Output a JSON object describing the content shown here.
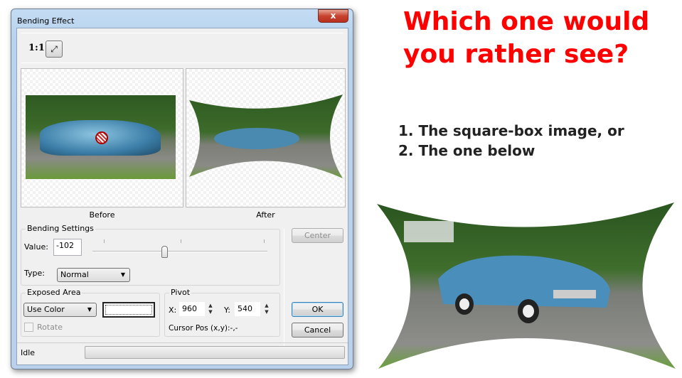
{
  "dialog": {
    "title": "Bending Effect",
    "close_label": "x",
    "toolbar": {
      "ratio_label": "1:1",
      "fit_icon": "fit-to-window-icon"
    },
    "preview": {
      "before_label": "Before",
      "after_label": "After"
    },
    "bending_settings": {
      "group_label": "Bending Settings",
      "value_label": "Value:",
      "value": "-102",
      "slider_percent": 41,
      "type_label": "Type:",
      "type_value": "Normal"
    },
    "exposed_area": {
      "group_label": "Exposed Area",
      "mode_value": "Use Color",
      "color": "#ffffff",
      "rotate_label": "Rotate",
      "rotate_checked": false
    },
    "pivot": {
      "group_label": "Pivot",
      "x_label": "X:",
      "x_value": "960",
      "y_label": "Y:",
      "y_value": "540",
      "cursor_label": "Cursor Pos (x,y):-,-"
    },
    "buttons": {
      "center": "Center",
      "ok": "OK",
      "cancel": "Cancel"
    },
    "status": {
      "text": "Idle",
      "progress": 0
    }
  },
  "slide": {
    "headline_line1": "Which one would",
    "headline_line2": "you rather see?",
    "option1": "1. The square-box image, or",
    "option2": "2. The one below",
    "headline_color": "#ff0000"
  }
}
